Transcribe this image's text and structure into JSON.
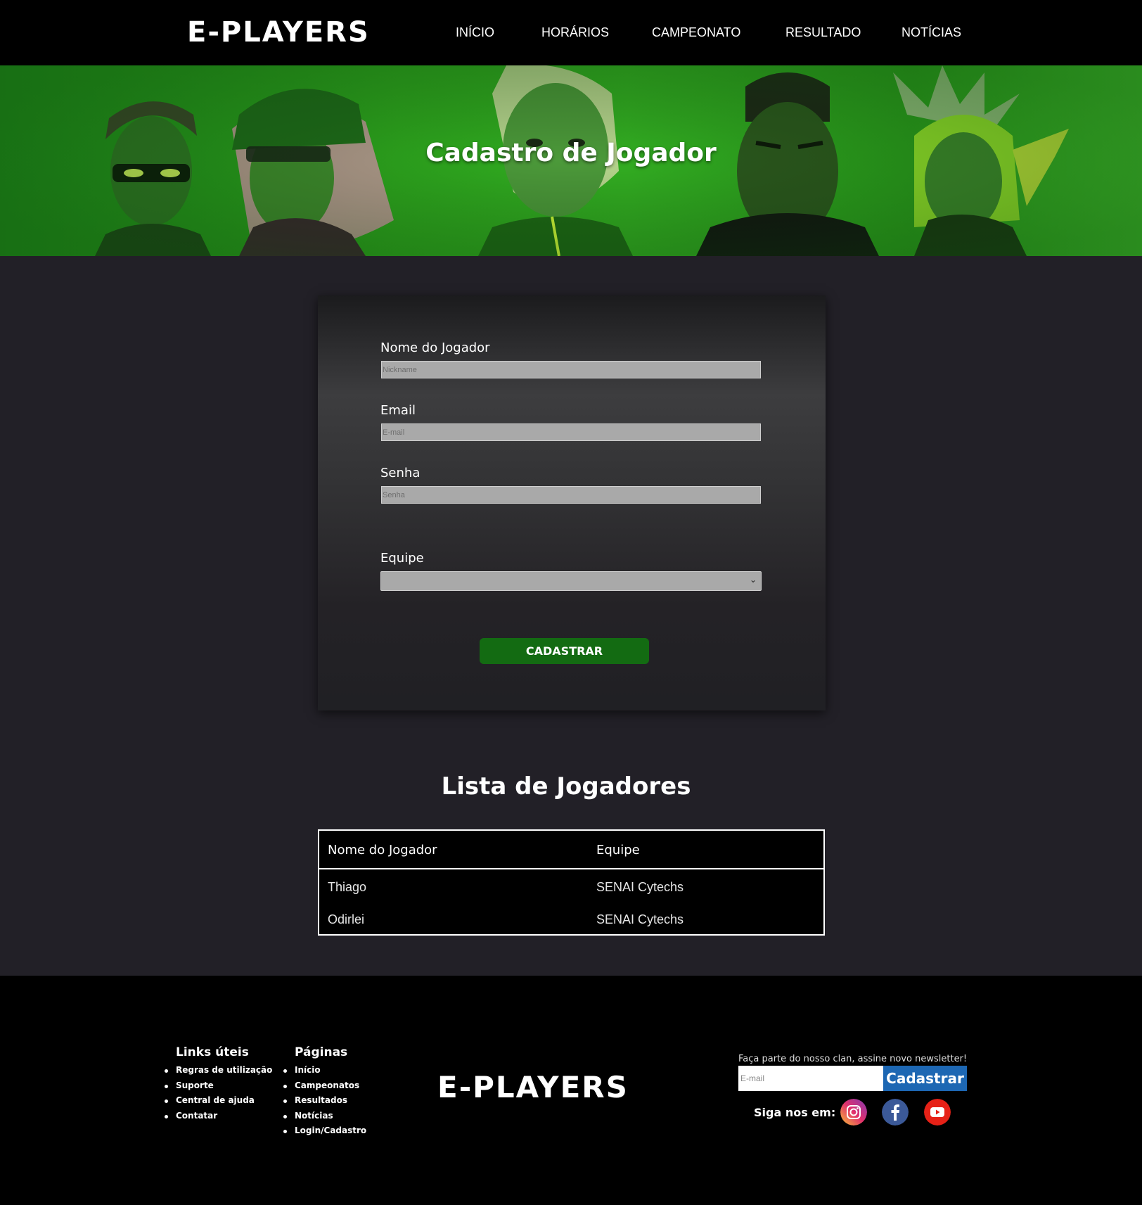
{
  "header": {
    "logo": "E-PLAYERS",
    "nav": [
      "INÍCIO",
      "HORÁRIOS",
      "CAMPEONATO",
      "RESULTADO",
      "NOTÍCIAS"
    ]
  },
  "hero": {
    "title": "Cadastro de Jogador",
    "background_color": "#2ea81e"
  },
  "form": {
    "fields": [
      {
        "label": "Nome do Jogador",
        "placeholder": "Nickname"
      },
      {
        "label": "Email",
        "placeholder": "E-mail"
      },
      {
        "label": "Senha",
        "placeholder": "Senha"
      }
    ],
    "select_label": "Equipe",
    "select_value": "",
    "submit_label": "CADASTRAR",
    "submit_color": "#136b12"
  },
  "list": {
    "title": "Lista de Jogadores",
    "columns": [
      "Nome do Jogador",
      "Equipe"
    ],
    "rows": [
      [
        "Thiago",
        "SENAI Cytechs"
      ],
      [
        "Odirlei",
        "SENAI Cytechs"
      ]
    ]
  },
  "footer": {
    "links_title": "Links úteis",
    "links": [
      "Regras de utilização",
      "Suporte",
      "Central de ajuda",
      "Contatar"
    ],
    "pages_title": "Páginas",
    "pages": [
      "Início",
      "Campeonatos",
      "Resultados",
      "Notícias",
      "Login/Cadastro"
    ],
    "logo": "E-PLAYERS",
    "newsletter_text": "Faça parte do nosso clan, assine novo newsletter!",
    "newsletter_placeholder": "E-mail",
    "newsletter_button": "Cadastrar",
    "newsletter_button_color": "#1d67b3",
    "follow_label": "Siga nos em:",
    "social": [
      "instagram-icon",
      "facebook-icon",
      "youtube-icon"
    ]
  }
}
